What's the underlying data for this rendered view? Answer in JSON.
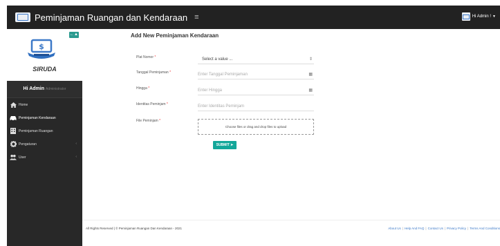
{
  "header": {
    "title": "Peminjaman Ruangan dan Kendaraan",
    "menu_icon": "hamburger-icon",
    "user_label": "Hi Admin !"
  },
  "sidebar": {
    "toggle_label": "←▲",
    "logo_text": "SIRUDA",
    "user_greeting": "Hi Admin",
    "user_role": "Administrator",
    "items": [
      {
        "label": "Home",
        "icon": "home-icon"
      },
      {
        "label": "Peminjaman Kendaraan",
        "icon": "car-icon"
      },
      {
        "label": "Peminjaman Ruangan",
        "icon": "building-icon"
      },
      {
        "label": "Pengaturan",
        "icon": "gear-icon"
      },
      {
        "label": "User",
        "icon": "users-icon"
      }
    ]
  },
  "form": {
    "title": "Add New Peminjaman Kendaraan",
    "fields": [
      {
        "label": "Plat Nomor",
        "value": "Select a value ..."
      },
      {
        "label": "Tanggal Peminjaman",
        "placeholder": "Enter Tanggal Peminjaman"
      },
      {
        "label": "Hingga",
        "placeholder": "Enter Hingga"
      },
      {
        "label": "Identitas Peminjam",
        "placeholder": "Enter Identitas Peminjam"
      },
      {
        "label": "File Peminjam",
        "upload_text": "Choose files or drag and drop files to upload"
      }
    ],
    "required_mark": "*",
    "submit_label": "SUBMIT"
  },
  "footer": {
    "copyright": "All Rights Reserved | © Peminjaman Ruangan Dan Kendaraan - 2021",
    "links": [
      "About Us",
      "Help And FAQ",
      "Contact Us",
      "Privacy Policy",
      "Terms And Conditions"
    ]
  },
  "colors": {
    "topbar": "#222222",
    "sidebar": "#282828",
    "accent": "#13a79a",
    "link": "#3c79c8"
  }
}
